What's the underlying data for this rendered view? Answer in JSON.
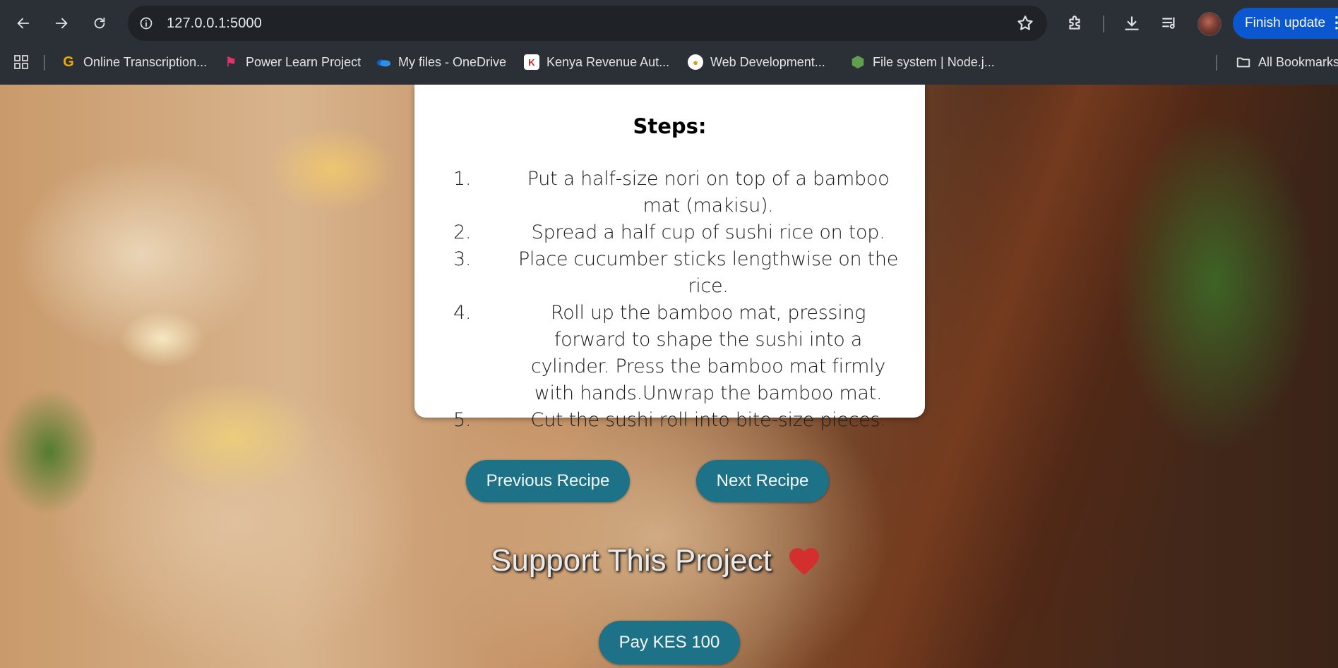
{
  "browser": {
    "url": "127.0.0.1:5000",
    "finish_update_label": "Finish update",
    "bookmarks": [
      {
        "label": "Online Transcription...",
        "icon": "transcription-favicon"
      },
      {
        "label": "Power Learn Project",
        "icon": "plp-favicon"
      },
      {
        "label": "My files - OneDrive",
        "icon": "onedrive-icon"
      },
      {
        "label": "Kenya Revenue Aut...",
        "icon": "kra-favicon"
      },
      {
        "label": "Web Development...",
        "icon": "webdev-favicon"
      },
      {
        "label": "File system | Node.j...",
        "icon": "nodejs-icon"
      }
    ],
    "all_bookmarks_label": "All Bookmarks"
  },
  "recipe": {
    "steps_title": "Steps:",
    "steps": [
      {
        "num": "1.",
        "text": "Put a half-size nori on top of a bamboo mat (makisu)."
      },
      {
        "num": "2.",
        "text": "Spread a half cup of sushi rice on top."
      },
      {
        "num": "3.",
        "text": "Place cucumber sticks lengthwise on the rice."
      },
      {
        "num": "4.",
        "text": "Roll up the bamboo mat, pressing forward to shape the sushi into a cylinder. Press the bamboo mat firmly with hands.Unwrap the bamboo mat."
      },
      {
        "num": "5.",
        "text": "Cut the sushi roll into bite-size pieces."
      }
    ]
  },
  "navigation": {
    "prev_label": "Previous Recipe",
    "next_label": "Next Recipe"
  },
  "support": {
    "title": "Support This Project",
    "pay_label": "Pay KES 100"
  },
  "colors": {
    "button_bg": "#1d7287",
    "heart": "#d32f2f",
    "update_button": "#0b57d0"
  }
}
